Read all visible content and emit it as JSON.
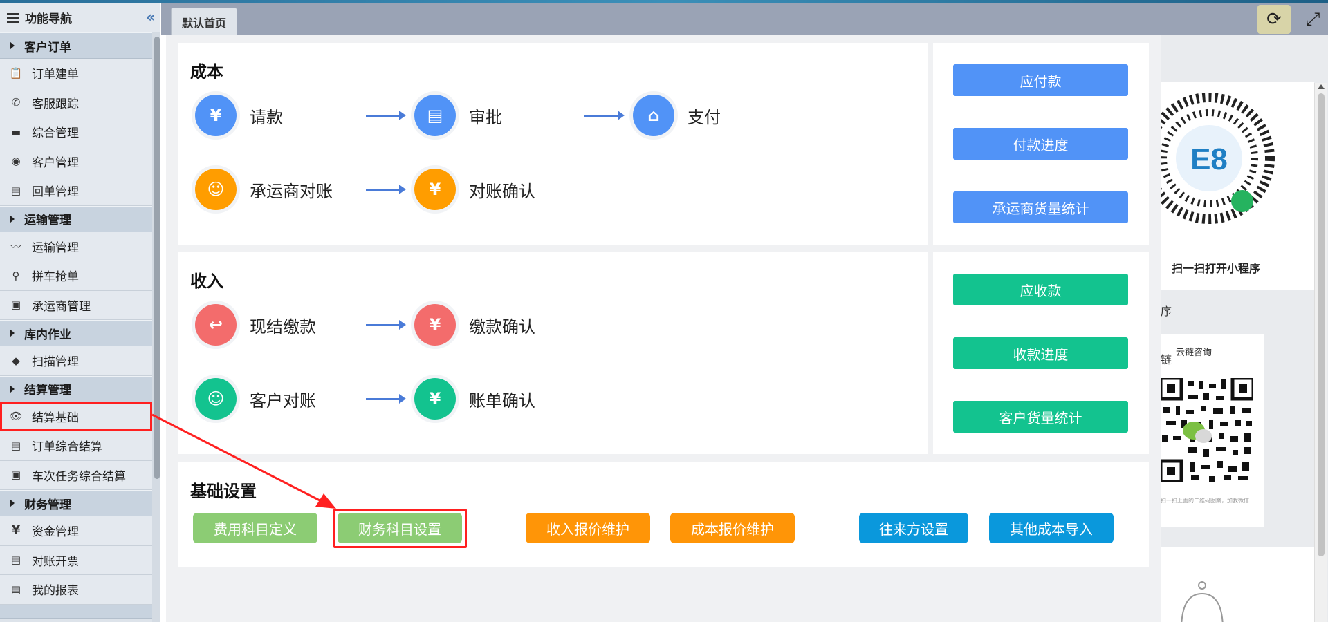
{
  "sidebar": {
    "title": "功能导航",
    "collapse_icon": "double-chevron-left-icon",
    "groups": [
      {
        "label": "客户订单",
        "items": [
          {
            "label": "订单建单",
            "icon": "clipboard-icon"
          },
          {
            "label": "客服跟踪",
            "icon": "phone-icon"
          },
          {
            "label": "综合管理",
            "icon": "monitor-icon"
          },
          {
            "label": "客户管理",
            "icon": "users-icon"
          },
          {
            "label": "回单管理",
            "icon": "document-icon"
          }
        ]
      },
      {
        "label": "运输管理",
        "items": [
          {
            "label": "运输管理",
            "icon": "route-icon"
          },
          {
            "label": "拼车抢单",
            "icon": "map-pin-icon"
          },
          {
            "label": "承运商管理",
            "icon": "bus-icon"
          }
        ]
      },
      {
        "label": "库内作业",
        "items": [
          {
            "label": "扫描管理",
            "icon": "box-icon"
          }
        ]
      },
      {
        "label": "结算管理",
        "items": [
          {
            "label": "结算基础",
            "icon": "eye-icon"
          },
          {
            "label": "订单综合结算",
            "icon": "document-icon"
          },
          {
            "label": "车次任务综合结算",
            "icon": "bus-icon"
          }
        ]
      },
      {
        "label": "财务管理",
        "items": [
          {
            "label": "资金管理",
            "icon": "yen-icon"
          },
          {
            "label": "对账开票",
            "icon": "document-icon"
          },
          {
            "label": "我的报表",
            "icon": "document-icon"
          }
        ]
      }
    ]
  },
  "tabs": [
    {
      "label": "默认首页"
    }
  ],
  "toolbar": {
    "refresh_icon": "refresh-icon",
    "fullscreen_icon": "fullscreen-icon"
  },
  "cost": {
    "title": "成本",
    "flow_row1": [
      "请款",
      "审批",
      "支付"
    ],
    "flow_row2": [
      "承运商对账",
      "对账确认"
    ],
    "buttons": [
      "应付款",
      "付款进度",
      "承运商货量统计"
    ]
  },
  "income": {
    "title": "收入",
    "flow_row1": [
      "现结缴款",
      "缴款确认"
    ],
    "flow_row2": [
      "客户对账",
      "账单确认"
    ],
    "buttons": [
      "应收款",
      "收款进度",
      "客户货量统计"
    ]
  },
  "basic": {
    "title": "基础设置",
    "buttons": [
      "费用科目定义",
      "财务科目设置",
      "收入报价维护",
      "成本报价维护",
      "往来方设置",
      "其他成本导入"
    ]
  },
  "right_panel": {
    "miniprogram_caption": "扫一扫打开小程序",
    "mini_logo": "E8",
    "section_mark": "序",
    "wechat_name": "云链咨询",
    "side_char": "链",
    "wechat_caption": "扫一扫上面的二维码图案，加我微信"
  },
  "colors": {
    "blue": "#5193f7",
    "teal": "#13c38f",
    "green": "#8ccc74",
    "orange": "#ff9507",
    "cyan": "#0a98dc",
    "highlight": "#ff2020"
  }
}
